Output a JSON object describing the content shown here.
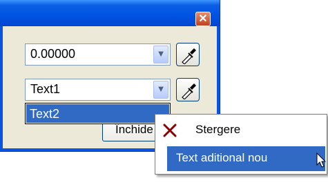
{
  "window": {
    "close_icon": "close-icon",
    "accent": "#0054e3"
  },
  "combo1": {
    "value": "0.00000",
    "arrow_icon": "chevron-down-icon"
  },
  "combo2": {
    "value": "Text1",
    "arrow_icon": "chevron-down-icon"
  },
  "dropdown": {
    "items": [
      {
        "label": "Text2",
        "selected": true
      }
    ]
  },
  "eyedropper_icon": "eyedropper-icon",
  "button_partial": {
    "label": "Închide"
  },
  "context_menu": {
    "items": [
      {
        "label": "Stergere",
        "icon": "delete-x-icon"
      },
      {
        "label": "Text aditional nou",
        "highlighted": true
      }
    ]
  },
  "colors": {
    "selection": "#316ac5",
    "delete_icon": "#8b0000"
  }
}
